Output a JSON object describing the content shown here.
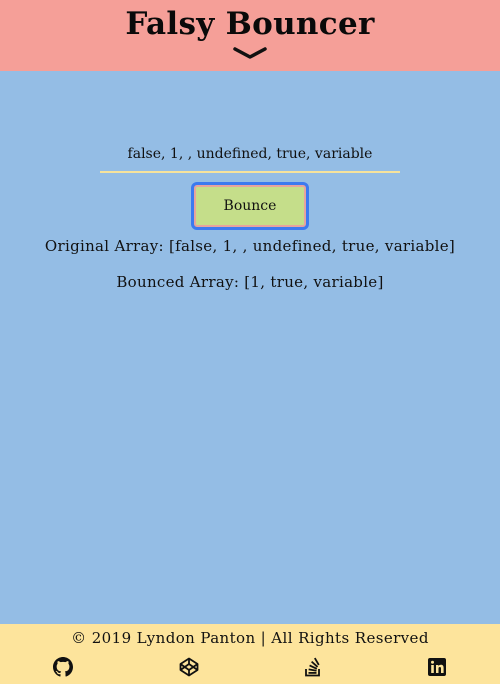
{
  "header": {
    "title": "Falsy Bouncer",
    "toggle_icon": "chevron-down-icon"
  },
  "form": {
    "input_value": "false, 1, , undefined, true, variable",
    "button_label": "Bounce"
  },
  "results": {
    "original": "Original Array: [false, 1, , undefined, true, variable]",
    "bounced": "Bounced Array: [1, true, variable]"
  },
  "footer": {
    "copyright": "© 2019 Lyndon Panton | All Rights Reserved",
    "social_icons": [
      "github-icon",
      "codepen-icon",
      "stackoverflow-icon",
      "linkedin-icon"
    ]
  },
  "colors": {
    "header_bg": "#f59f98",
    "main_bg": "#94bde5",
    "footer_bg": "#fde49c",
    "button_bg": "#c5de8a",
    "button_focus_ring": "#3c7af0",
    "input_underline": "#f6e39c"
  }
}
